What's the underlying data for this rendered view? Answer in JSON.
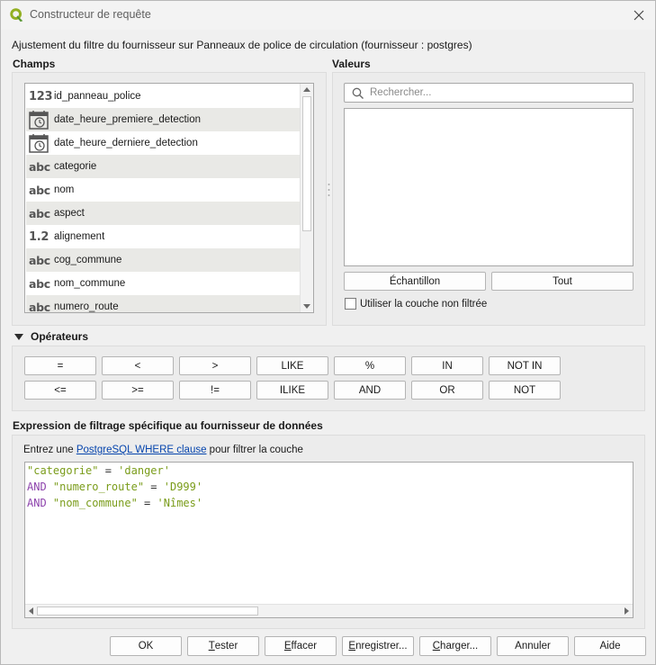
{
  "window": {
    "title": "Constructeur de requête"
  },
  "description": "Ajustement du filtre du fournisseur sur Panneaux de police de circulation (fournisseur : postgres)",
  "fields": {
    "group_title": "Champs",
    "items": [
      {
        "type_icon": "123",
        "label": "id_panneau_police"
      },
      {
        "type_icon": "datetime",
        "label": "date_heure_premiere_detection"
      },
      {
        "type_icon": "datetime",
        "label": "date_heure_derniere_detection"
      },
      {
        "type_icon": "abc",
        "label": "categorie"
      },
      {
        "type_icon": "abc",
        "label": "nom"
      },
      {
        "type_icon": "abc",
        "label": "aspect"
      },
      {
        "type_icon": "1.2",
        "label": "alignement"
      },
      {
        "type_icon": "abc",
        "label": "cog_commune"
      },
      {
        "type_icon": "abc",
        "label": "nom_commune"
      },
      {
        "type_icon": "abc",
        "label": "numero_route"
      }
    ]
  },
  "values": {
    "group_title": "Valeurs",
    "search_placeholder": "Rechercher...",
    "sample_button": "Échantillon",
    "all_button": "Tout",
    "unfiltered_checkbox_label": "Utiliser la couche non filtrée"
  },
  "operators": {
    "group_title": "Opérateurs",
    "row1": [
      "=",
      "<",
      ">",
      "LIKE",
      "%",
      "IN",
      "NOT IN"
    ],
    "row2": [
      "<=",
      ">=",
      "!=",
      "ILIKE",
      "AND",
      "OR",
      "NOT"
    ]
  },
  "expression": {
    "group_title": "Expression de filtrage spécifique au fournisseur de données",
    "help_prefix": "Entrez une ",
    "help_link": "PostgreSQL WHERE clause",
    "help_suffix": " pour filtrer la couche",
    "lines": [
      {
        "kw": "",
        "field": "\"categorie\"",
        "op": " = ",
        "value": "'danger'"
      },
      {
        "kw": "AND ",
        "field": "\"numero_route\"",
        "op": " = ",
        "value": "'D999'"
      },
      {
        "kw": "AND ",
        "field": "\"nom_commune\"",
        "op": " = ",
        "value": "'Nîmes'"
      }
    ]
  },
  "buttons": {
    "ok": "OK",
    "test_u": "T",
    "test_rest": "ester",
    "clear_u": "E",
    "clear_rest": "ffacer",
    "save_u": "E",
    "save_rest": "nregistrer...",
    "load_u": "C",
    "load_rest": "harger...",
    "cancel": "Annuler",
    "help": "Aide"
  },
  "colors": {
    "accent": "#589632",
    "keyword": "#8e44ad",
    "literal": "#7a9c1a",
    "link": "#0645ad"
  }
}
